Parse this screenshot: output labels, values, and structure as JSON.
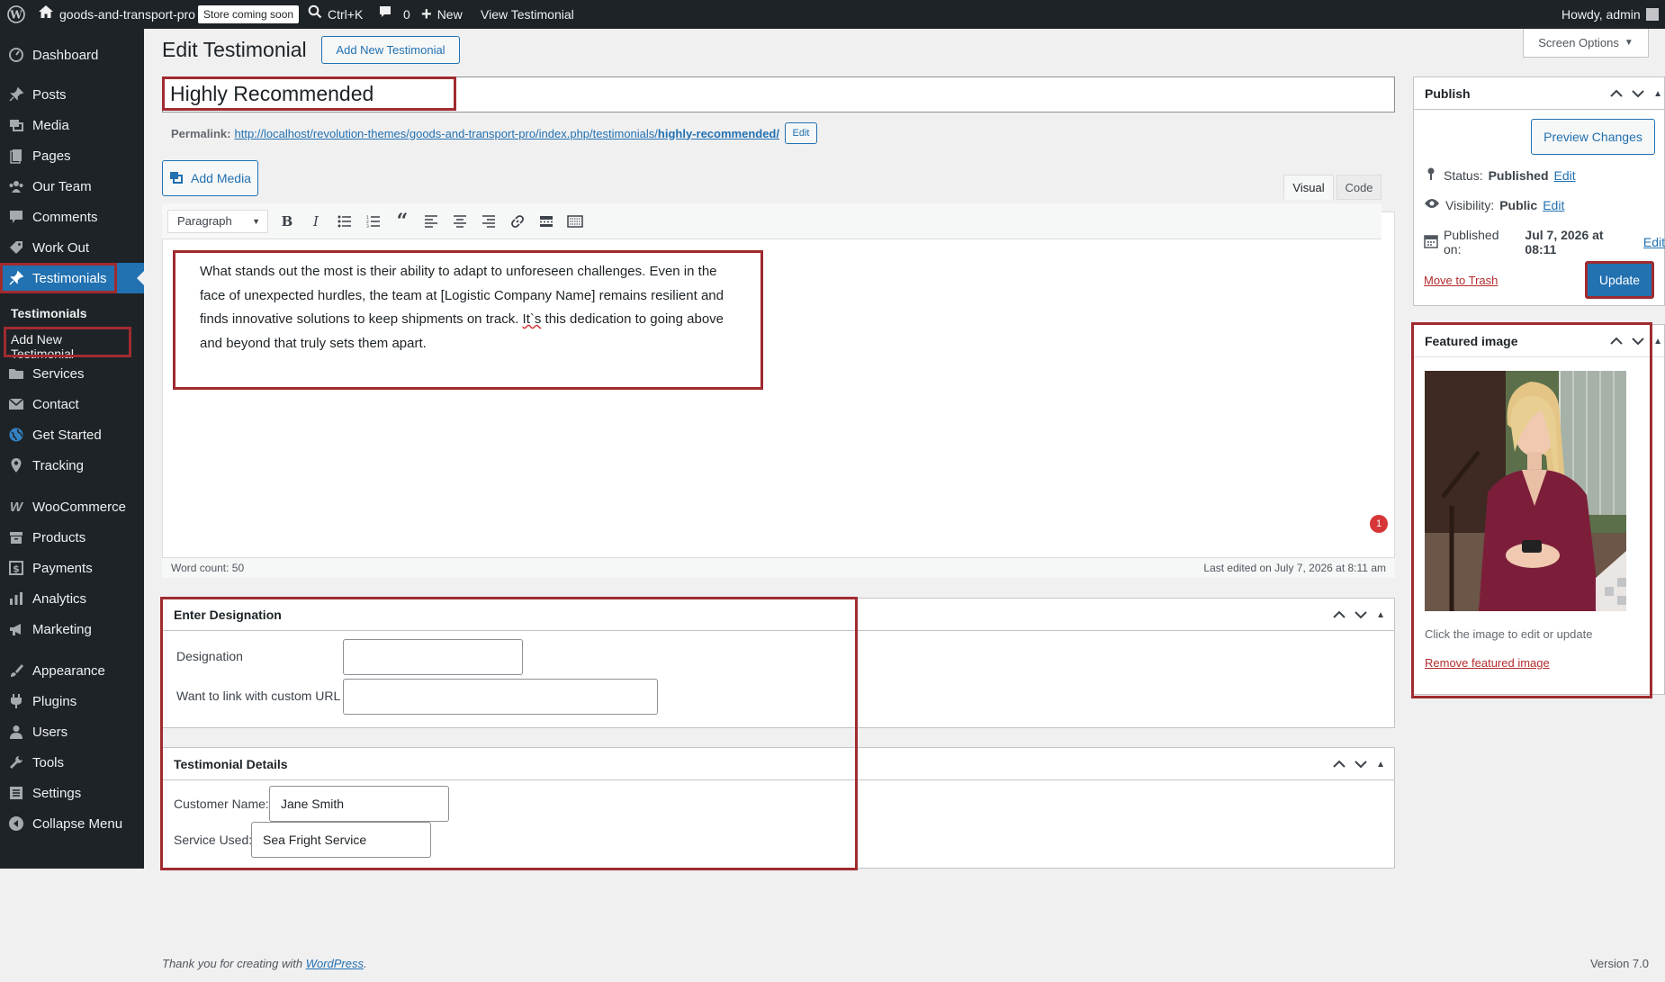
{
  "adminbar": {
    "site_name": "goods-and-transport-pro",
    "store_badge": "Store coming soon",
    "search_shortcut": "Ctrl+K",
    "comments_count": "0",
    "new_label": "New",
    "view_label": "View Testimonial",
    "howdy": "Howdy, admin"
  },
  "sidebar": {
    "items": [
      {
        "label": "Dashboard"
      },
      {
        "label": "Posts"
      },
      {
        "label": "Media"
      },
      {
        "label": "Pages"
      },
      {
        "label": "Our Team"
      },
      {
        "label": "Comments"
      },
      {
        "label": "Work Out"
      },
      {
        "label": "Testimonials"
      },
      {
        "label": "Services"
      },
      {
        "label": "Contact"
      },
      {
        "label": "Get Started"
      },
      {
        "label": "Tracking"
      },
      {
        "label": "WooCommerce"
      },
      {
        "label": "Products"
      },
      {
        "label": "Payments"
      },
      {
        "label": "Analytics"
      },
      {
        "label": "Marketing"
      },
      {
        "label": "Appearance"
      },
      {
        "label": "Plugins"
      },
      {
        "label": "Users"
      },
      {
        "label": "Tools"
      },
      {
        "label": "Settings"
      },
      {
        "label": "Collapse Menu"
      }
    ],
    "submenu": {
      "testimonials": "Testimonials",
      "add_new": "Add New Testimonial"
    }
  },
  "header": {
    "title": "Edit Testimonial",
    "add_new_button": "Add New Testimonial",
    "screen_options": "Screen Options"
  },
  "post": {
    "title": "Highly Recommended",
    "permalink_label": "Permalink:",
    "permalink_base": "http://localhost/revolution-themes/goods-and-transport-pro/index.php/testimonials/",
    "permalink_slug": "highly-recommended/",
    "permalink_edit": "Edit"
  },
  "editor": {
    "add_media": "Add Media",
    "tab_visual": "Visual",
    "tab_code": "Code",
    "format_select": "Paragraph",
    "content_part1": "What stands out the most is their ability to adapt to unforeseen challenges. Even in the face of unexpected hurdles, the team at [Logistic Company Name] remains resilient and finds innovative solutions to keep shipments on track. ",
    "content_misspelled": "It`s",
    "content_part2": " this dedication to going above and beyond that truly sets them apart.",
    "word_count": "Word count: 50",
    "last_edited": "Last edited on July 7, 2026 at 8:11 am",
    "notification_count": "1"
  },
  "designation_box": {
    "title": "Enter Designation",
    "designation_label": "Designation",
    "designation_value": "",
    "url_label": "Want to link with custom URL",
    "url_value": ""
  },
  "details_box": {
    "title": "Testimonial Details",
    "customer_label": "Customer Name:",
    "customer_value": "Jane Smith",
    "service_label": "Service Used:",
    "service_value": "Sea Fright Service"
  },
  "publish": {
    "title": "Publish",
    "preview_button": "Preview Changes",
    "status_label": "Status:",
    "status_value": "Published",
    "visibility_label": "Visibility:",
    "visibility_value": "Public",
    "published_label": "Published on:",
    "published_value": "Jul 7, 2026 at 08:11",
    "edit_link": "Edit",
    "trash_link": "Move to Trash",
    "update_button": "Update"
  },
  "featured_image": {
    "title": "Featured image",
    "hint": "Click the image to edit or update",
    "remove_link": "Remove featured image"
  },
  "footer": {
    "thanks_prefix": "Thank you for creating with ",
    "wordpress_link": "WordPress",
    "thanks_suffix": ".",
    "version": "Version 7.0"
  },
  "colors": {
    "admin_bar": "#1d2327",
    "accent": "#2271b1",
    "highlight_red": "#a02b2f"
  }
}
